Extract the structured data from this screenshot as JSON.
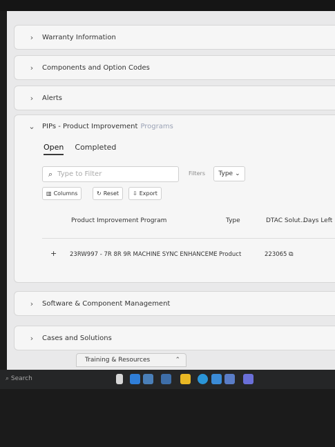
{
  "sections": {
    "warranty": "Warranty Information",
    "components": "Components and Option Codes",
    "alerts": "Alerts",
    "software": "Software & Component Management",
    "cases": "Cases and Solutions"
  },
  "pips": {
    "title_prefix": "PIPs - Product Improvement",
    "title_suffix": "Programs",
    "tabs": [
      "Open",
      "Completed"
    ],
    "filter_placeholder": "Type to Filter",
    "filters_label": "Filters",
    "type_button": "Type",
    "toolbar": {
      "columns": "Columns",
      "reset": "Reset",
      "export": "Export"
    },
    "columns": [
      "Product Improvement Program",
      "Type",
      "DTAC Solut...",
      "Days Left"
    ],
    "row": {
      "expand": "+",
      "program": "23RW997 - 7R 8R 9R MACHINE SYNC ENHANCEME",
      "type": "Product",
      "dtac": "223065"
    }
  },
  "taskbar": {
    "search": "Search"
  },
  "popup": {
    "label": "Training & Resources"
  }
}
